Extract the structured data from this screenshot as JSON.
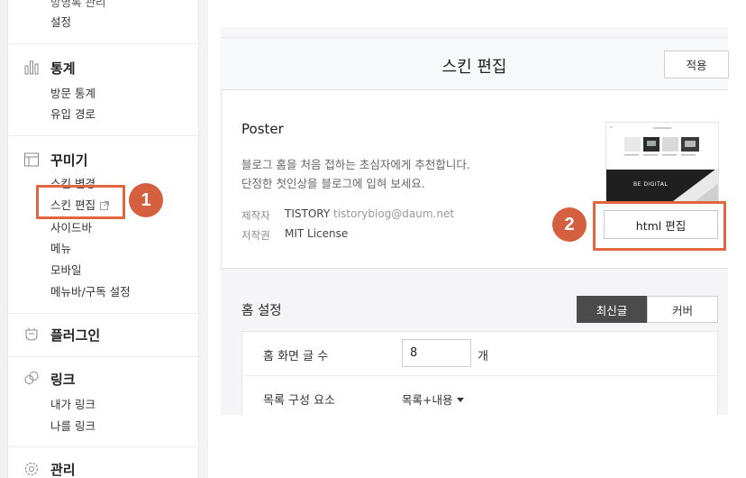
{
  "sidebar": {
    "top_partial": "방명록 관리",
    "settings": "설정",
    "stats": {
      "title": "통계",
      "items": [
        "방문 통계",
        "유입 경로"
      ]
    },
    "decorate": {
      "title": "꾸미기",
      "items": [
        "스킨 변경",
        "스킨 편집",
        "사이드바",
        "메뉴",
        "모바일",
        "메뉴바/구독 설정"
      ]
    },
    "plugin": {
      "title": "플러그인"
    },
    "link": {
      "title": "링크",
      "items": [
        "내가 링크",
        "나를 링크"
      ]
    },
    "manage": {
      "title": "관리"
    }
  },
  "annotations": {
    "badge1": "1",
    "badge2": "2",
    "accent": "#d4603f"
  },
  "panel": {
    "title": "스킨 편집",
    "apply_label": "적용",
    "skin": {
      "name": "Poster",
      "desc_line1": "블로그 홈을 처음 접하는 초심자에게 추천합니다.",
      "desc_line2": "단정한 첫인상을 블로그에 입혀 보세요.",
      "maker_label": "제작자",
      "maker_value": "TISTORY",
      "maker_email": "tistoryblog@daum.net",
      "license_label": "저작권",
      "license_value": "MIT License",
      "thumb_caption": "BE DIGITAL"
    },
    "html_edit_label": "html 편집",
    "home": {
      "title": "홈 설정",
      "tab_latest": "최신글",
      "tab_cover": "커버",
      "post_count_label": "홈 화면 글 수",
      "post_count_value": "8",
      "post_count_unit": "개",
      "list_label": "목록 구성 요소",
      "list_value": "목록+내용"
    }
  }
}
